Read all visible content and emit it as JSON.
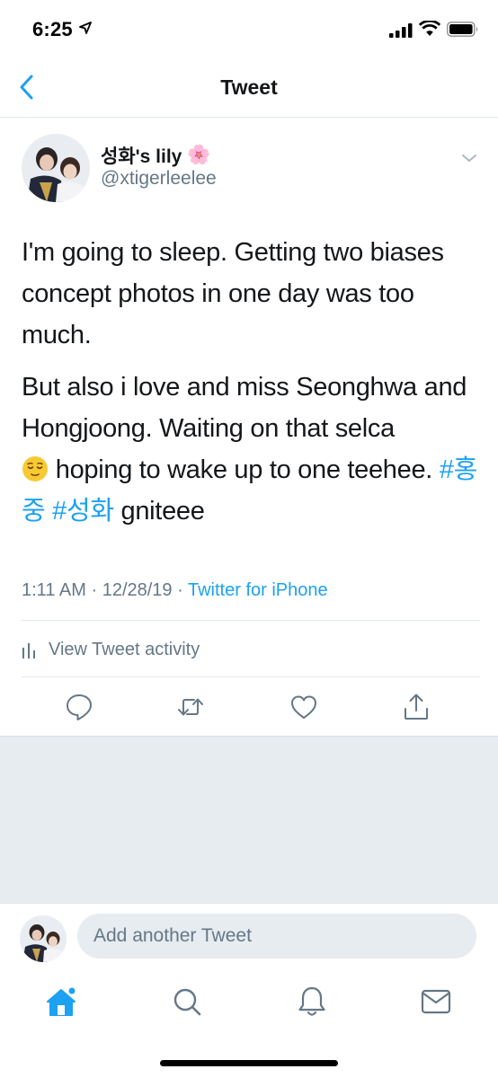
{
  "status_bar": {
    "time": "6:25"
  },
  "nav": {
    "title": "Tweet"
  },
  "tweet": {
    "author_name": "성화's lily",
    "author_name_emoji": "🌸",
    "author_handle": "@xtigerleelee",
    "paragraph1": "I'm going to sleep. Getting two biases concept photos in one day was too much.",
    "paragraph2_a": "But also i love and miss Seonghwa and Hongjoong. Waiting on that selca",
    "paragraph2_b": " hoping to wake up to one teehee. ",
    "hashtag1": "#홍중",
    "hashtag2": "#성화",
    "paragraph2_end": " gniteee",
    "time": "1:11 AM",
    "date": "12/28/19",
    "separator": "·",
    "source": "Twitter for iPhone"
  },
  "activity": {
    "label": "View Tweet activity"
  },
  "actions": [
    "reply-icon",
    "retweet-icon",
    "like-icon",
    "share-icon"
  ],
  "composer": {
    "placeholder": "Add another Tweet"
  },
  "tab_bar": [
    "home-icon",
    "search-icon",
    "notifications-icon",
    "messages-icon"
  ],
  "colors": {
    "accent": "#1da1f2",
    "text": "#14171a",
    "secondary": "#657786",
    "background_gray": "#e6ecf0"
  }
}
